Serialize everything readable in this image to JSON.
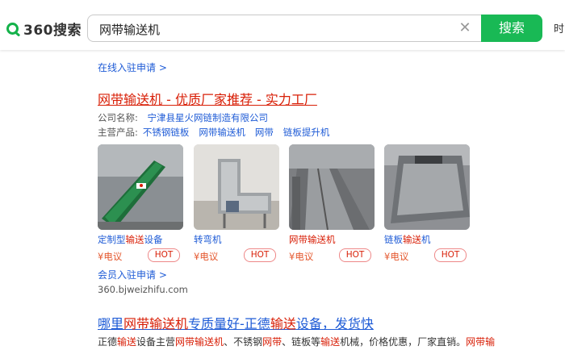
{
  "header": {
    "logo_text": "360搜索",
    "query": "网带输送机",
    "search_button": "搜索",
    "more_label": "时"
  },
  "top_entry_link": "在线入驻申请 >",
  "result1": {
    "title_parts": [
      "网带输送机",
      " - 优质厂家推荐 - 实力工厂"
    ],
    "company_label": "公司名称:",
    "company_name": "宁津县星火网链制造有限公司",
    "products_label": "主营产品:",
    "products": [
      "不锈钢链板",
      "网带输送机",
      "网带",
      "链板提升机"
    ],
    "cards": [
      {
        "name_parts": [
          "定制型",
          "输送",
          "设备"
        ],
        "price": "¥电议",
        "badge": "HOT"
      },
      {
        "name_parts": [
          "转弯机",
          "",
          ""
        ],
        "price": "¥电议",
        "badge": "HOT"
      },
      {
        "name_parts": [
          "",
          "网带输送机",
          ""
        ],
        "price": "¥电议",
        "badge": "HOT"
      },
      {
        "name_parts": [
          "链板",
          "输送",
          "机"
        ],
        "price": "¥电议",
        "badge": "HOT"
      }
    ],
    "member_link": "会员入驻申请 >",
    "url": "360.bjweizhifu.com"
  },
  "result2": {
    "title_parts": [
      "哪里",
      "网带输送机",
      "专质量好-正德",
      "输送",
      "设备，发货快"
    ],
    "desc_parts": [
      "正德",
      "输送",
      "设备主营",
      "网带输送机",
      "、不锈钢",
      "网带",
      "、链板等",
      "输送",
      "机械，价格优惠，厂家直销。",
      "网带输",
      ""
    ]
  },
  "colors": {
    "brand_green": "#19b955",
    "link_blue": "#1e5bd6",
    "highlight_red": "#d81e06",
    "price_orange": "#e4582e"
  },
  "icons": {
    "logo": "360-logo-icon",
    "clear": "close-icon"
  }
}
